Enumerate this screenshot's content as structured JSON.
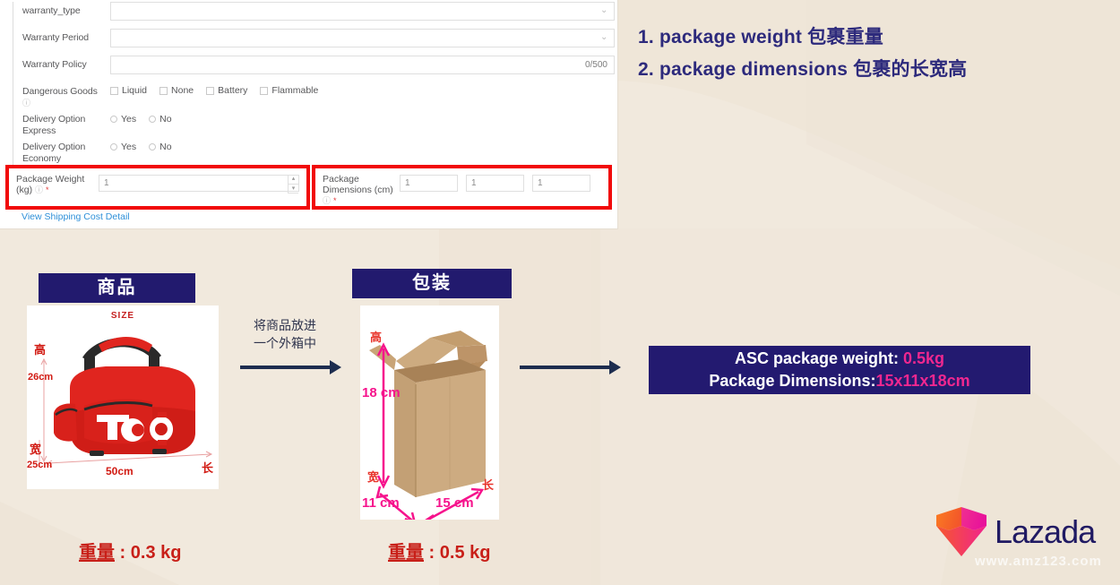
{
  "form": {
    "rows": [
      {
        "label": "warranty_type",
        "type": "select",
        "value": ""
      },
      {
        "label": "Warranty Period",
        "type": "select",
        "value": ""
      },
      {
        "label": "Warranty Policy",
        "type": "text",
        "value": "",
        "counter": "0/500"
      }
    ],
    "dangerous_goods": {
      "label": "Dangerous Goods",
      "options": [
        "Liquid",
        "None",
        "Battery",
        "Flammable"
      ]
    },
    "delivery_express": {
      "label": "Delivery Option Express",
      "options": [
        "Yes",
        "No"
      ]
    },
    "delivery_economy": {
      "label": "Delivery Option Economy",
      "options": [
        "Yes",
        "No"
      ]
    },
    "package_weight": {
      "label": "Package Weight (kg)",
      "value": "1"
    },
    "package_dimensions": {
      "label": "Package Dimensions (cm)",
      "values": [
        "1",
        "1",
        "1"
      ]
    },
    "shipping_link": "View Shipping Cost Detail"
  },
  "notes": [
    "1. package weight 包裹重量",
    "2. package dimensions 包裹的长宽高"
  ],
  "diagram": {
    "product_header": "商品",
    "package_header": "包装",
    "mid_caption_line1": "将商品放进",
    "mid_caption_line2": "一个外箱中",
    "bag": {
      "size_caption": "SIZE",
      "height_cn": "高",
      "height_value": "26cm",
      "width_cn": "宽",
      "width_value": "25cm",
      "length_cn": "长",
      "length_value": "50cm"
    },
    "box": {
      "height_cn": "高",
      "height_value": "18 cm",
      "width_cn": "宽",
      "width_value": "11 cm",
      "length_cn": "长",
      "length_value": "15 cm"
    },
    "result": {
      "weight_label": "ASC package weight:",
      "weight_value": "0.5kg",
      "dimensions_label": "Package Dimensions:",
      "dimensions_value": "15x11x18cm"
    },
    "product_weight_label": "重量",
    "product_weight_sep": " : ",
    "product_weight_value": "0.3 kg",
    "package_weight_label": "重量",
    "package_weight_sep": " : ",
    "package_weight_value": "0.5 kg"
  },
  "branding": {
    "logo_text": "Lazada",
    "watermark": "www.amz123.com"
  },
  "colors": {
    "background": "#f1e9dd",
    "navy": "#231a70",
    "note_text": "#2d2a7c",
    "highlight_red": "#f10909",
    "pink": "#f6128c",
    "dim_red": "#d11a12",
    "link_blue": "#2f8fd8"
  }
}
